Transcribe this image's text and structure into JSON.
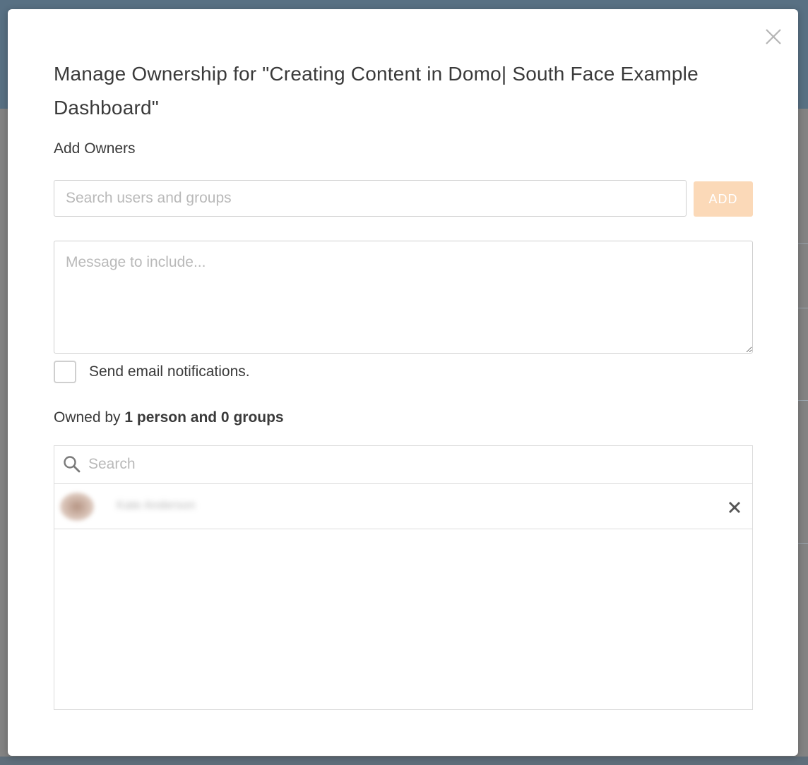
{
  "dialog": {
    "title": "Manage Ownership for \"Creating Content in Domo| South Face Example Dashboard\"",
    "close_icon": "close-icon"
  },
  "add_owners": {
    "label": "Add Owners",
    "search_placeholder": "Search users and groups",
    "search_value": "",
    "add_button_label": "ADD",
    "message_placeholder": "Message to include...",
    "message_value": "",
    "email_checkbox_label": "Send email notifications.",
    "email_checked": false
  },
  "owned_by": {
    "prefix": "Owned by",
    "summary": "1 person and 0 groups"
  },
  "owner_list": {
    "search_placeholder": "Search",
    "search_icon": "search-icon",
    "owners": [
      {
        "name": "Kate Anderson",
        "remove_icon": "close-icon"
      }
    ]
  },
  "colors": {
    "add_button_disabled": "#fbd9b8",
    "backdrop_header": "#587083",
    "text": "#3a3a3a"
  }
}
